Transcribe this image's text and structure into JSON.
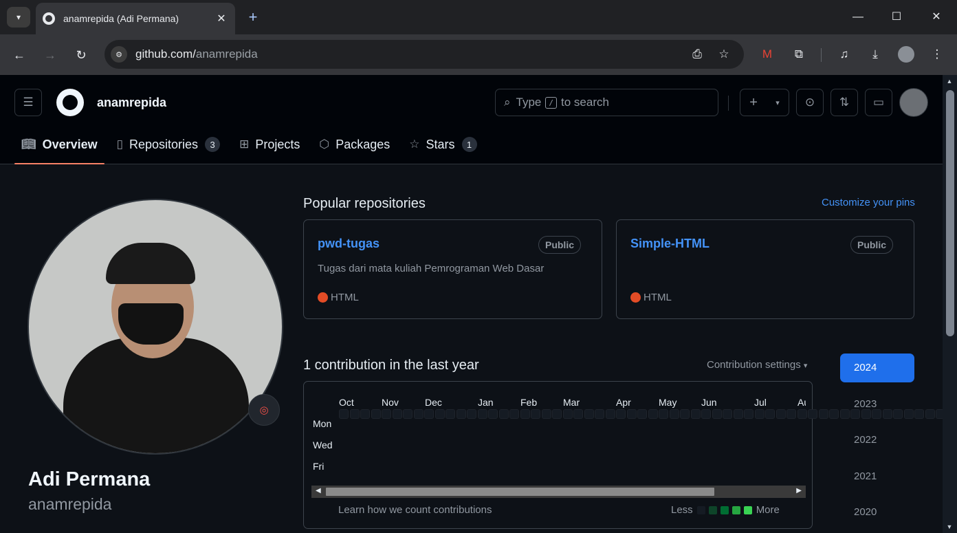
{
  "browser": {
    "tab_title": "anamrepida (Adi Permana)",
    "url_host": "github.com/",
    "url_path": "anamrepida"
  },
  "header": {
    "username": "anamrepida",
    "search_prefix": "Type",
    "search_key": "/",
    "search_suffix": "to search"
  },
  "nav": {
    "overview": "Overview",
    "repositories": "Repositories",
    "repositories_count": "3",
    "projects": "Projects",
    "packages": "Packages",
    "stars": "Stars",
    "stars_count": "1"
  },
  "profile": {
    "full_name": "Adi Permana",
    "login": "anamrepida"
  },
  "popular": {
    "title": "Popular repositories",
    "customize": "Customize your pins",
    "repos": [
      {
        "name": "pwd-tugas",
        "visibility": "Public",
        "description": "Tugas dari mata kuliah Pemrograman Web Dasar",
        "language": "HTML",
        "language_color": "#e34c26"
      },
      {
        "name": "Simple-HTML",
        "visibility": "Public",
        "description": "",
        "language": "HTML",
        "language_color": "#e34c26"
      }
    ]
  },
  "contributions": {
    "title": "1 contribution in the last year",
    "settings": "Contribution settings",
    "months": [
      "Oct",
      "Nov",
      "Dec",
      "Jan",
      "Feb",
      "Mar",
      "Apr",
      "May",
      "Jun",
      "Jul",
      "Au"
    ],
    "days": [
      "Mon",
      "Wed",
      "Fri"
    ],
    "learn": "Learn how we count contributions",
    "less": "Less",
    "more": "More",
    "legend_colors": [
      "#151b23",
      "#0e4429",
      "#006d32",
      "#26a641",
      "#39d353"
    ],
    "active_color": "#39d353",
    "contribution_count": 1,
    "contribution_date": "Mar"
  },
  "years": [
    "2024",
    "2023",
    "2022",
    "2021",
    "2020"
  ],
  "selected_year": "2024",
  "colors": {
    "accent": "#4493f8",
    "tab_underline": "#f78166",
    "year_selected": "#1f6feb"
  }
}
